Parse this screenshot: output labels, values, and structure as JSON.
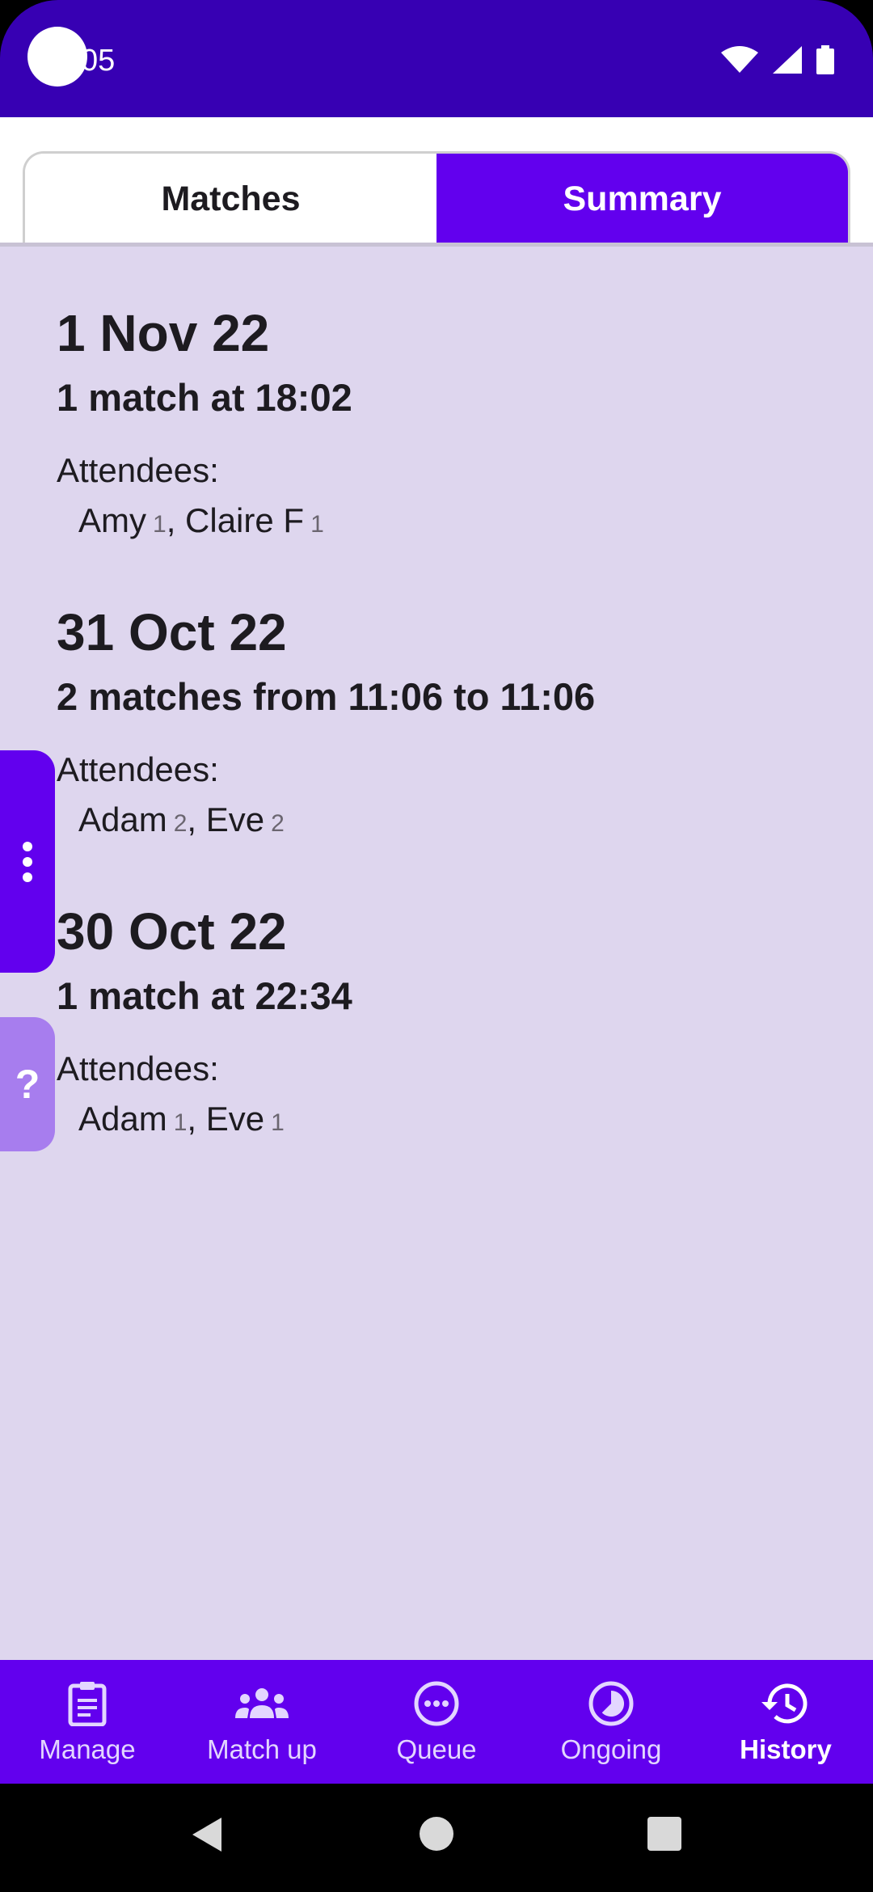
{
  "status_bar": {
    "time": "05"
  },
  "tabs": [
    {
      "label": "Matches",
      "active": false
    },
    {
      "label": "Summary",
      "active": true
    }
  ],
  "days": [
    {
      "date": "1 Nov 22",
      "summary": "1 match at 18:02",
      "attendees_label": "Attendees:",
      "attendees": [
        {
          "name": "Amy",
          "count": "1"
        },
        {
          "name": "Claire F",
          "count": "1"
        }
      ]
    },
    {
      "date": "31 Oct 22",
      "summary": "2 matches from 11:06 to 11:06",
      "attendees_label": "Attendees:",
      "attendees": [
        {
          "name": "Adam",
          "count": "2"
        },
        {
          "name": "Eve",
          "count": "2"
        }
      ]
    },
    {
      "date": "30 Oct 22",
      "summary": "1 match at 22:34",
      "attendees_label": "Attendees:",
      "attendees": [
        {
          "name": "Adam",
          "count": "1"
        },
        {
          "name": "Eve",
          "count": "1"
        }
      ]
    }
  ],
  "side": {
    "help_label": "?"
  },
  "bottom_nav": [
    {
      "label": "Manage",
      "icon": "clipboard-icon"
    },
    {
      "label": "Match up",
      "icon": "group-icon"
    },
    {
      "label": "Queue",
      "icon": "more-circle-icon"
    },
    {
      "label": "Ongoing",
      "icon": "timelapse-icon"
    },
    {
      "label": "History",
      "icon": "history-icon",
      "active": true
    }
  ],
  "colors": {
    "status_bar": "#3700B3",
    "primary": "#6200EE",
    "content_bg": "#DED6EE",
    "help_tab": "#A77DEE"
  }
}
